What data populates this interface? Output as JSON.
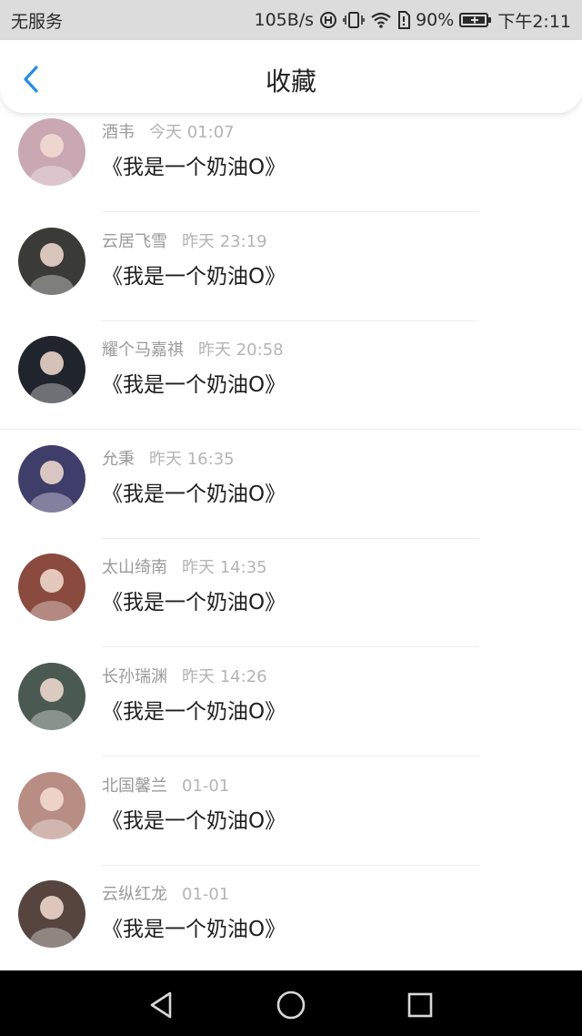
{
  "status_bar": {
    "carrier": "无服务",
    "speed": "105B/s",
    "battery": "90%",
    "time": "下午2:11",
    "icons": [
      "data-saver-icon",
      "vibrate-icon",
      "wifi-icon",
      "sim-icon",
      "battery-icon"
    ]
  },
  "header": {
    "title": "收藏",
    "back_icon": "chevron-left-icon"
  },
  "colors": {
    "accent": "#2b8ce0"
  },
  "favorites": [
    {
      "name": "酒韦",
      "time": "今天 01:07",
      "message": "《我是一个奶油O》",
      "avatar_color": "#c9a7b3"
    },
    {
      "name": "云居飞雪",
      "time": "昨天 23:19",
      "message": "《我是一个奶油O》",
      "avatar_color": "#3a3a36"
    },
    {
      "name": "耀个马嘉祺",
      "time": "昨天 20:58",
      "message": "《我是一个奶油O》",
      "avatar_color": "#20242c"
    },
    {
      "name": "允秉",
      "time": "昨天 16:35",
      "message": "《我是一个奶油O》",
      "avatar_color": "#3f3d6a"
    },
    {
      "name": "太山绮南",
      "time": "昨天 14:35",
      "message": "《我是一个奶油O》",
      "avatar_color": "#8a4a3e"
    },
    {
      "name": "长孙瑞渊",
      "time": "昨天 14:26",
      "message": "《我是一个奶油O》",
      "avatar_color": "#4a5a52"
    },
    {
      "name": "北国馨兰",
      "time": "01-01",
      "message": "《我是一个奶油O》",
      "avatar_color": "#b88e84"
    },
    {
      "name": "云纵红龙",
      "time": "01-01",
      "message": "《我是一个奶油O》",
      "avatar_color": "#56443e"
    }
  ],
  "bottom_nav": [
    "back-triangle-icon",
    "home-circle-icon",
    "recents-square-icon"
  ]
}
